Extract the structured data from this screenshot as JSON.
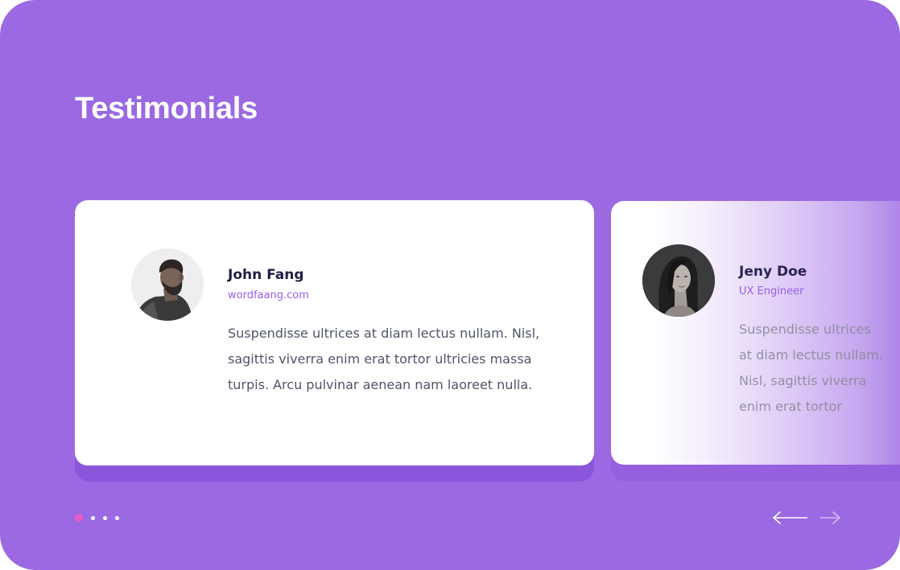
{
  "section": {
    "title": "Testimonials"
  },
  "testimonials": [
    {
      "name": "John Fang",
      "subtitle": "wordfaang.com",
      "quote": "Suspendisse ultrices at diam lectus nullam. Nisl, sagittis viverra enim erat tortor ultricies massa turpis. Arcu pulvinar aenean nam laoreet nulla."
    },
    {
      "name": "Jeny Doe",
      "subtitle": "UX Engineer",
      "quote": "Suspendisse ultrices at diam lectus nullam. Nisl, sagittis viverra enim erat tortor"
    }
  ],
  "pagination": {
    "total": 4,
    "active_index": 0
  },
  "navigation": {
    "prev_icon": "arrow-left-icon",
    "next_icon": "arrow-right-icon"
  },
  "colors": {
    "background": "#9B69E2",
    "accent": "#9B5DE5",
    "active_dot": "#E85DC8",
    "card": "#FFFFFF",
    "name_text": "#1F1F46"
  }
}
